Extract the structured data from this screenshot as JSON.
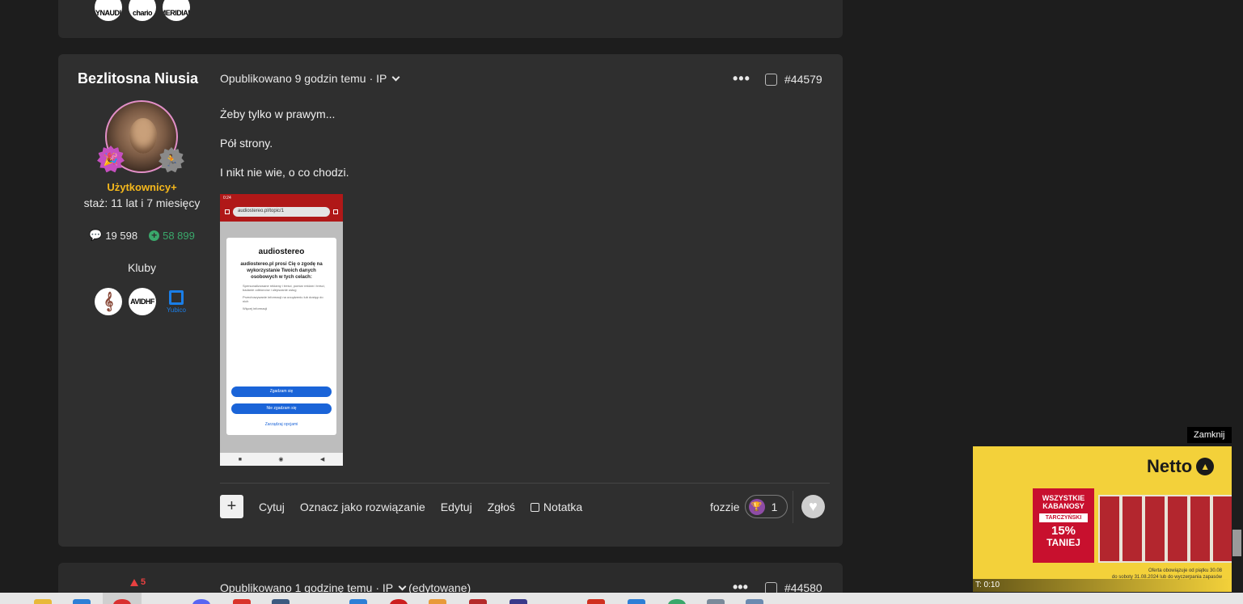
{
  "prev_post": {
    "clubs": [
      "DYNAUDIO",
      "chario",
      "MERIDIAN"
    ]
  },
  "post": {
    "author": {
      "name": "Bezlitosna Niusia",
      "group": "Użytkownicy+",
      "since": "staż: 11 lat i 7 miesięcy",
      "posts_count": "19 598",
      "reputation": "58 899",
      "clubs_label": "Kluby",
      "clubs": [
        "",
        "AVIDHF",
        "Yubico"
      ]
    },
    "header": {
      "published": "Opublikowano 9 godzin temu",
      "ip": "· IP",
      "post_number": "#44579"
    },
    "content": {
      "lines": [
        "Żeby tylko w prawym...",
        "Pół strony.",
        "I nikt nie wie, o co chodzi."
      ]
    },
    "embedded_screenshot": {
      "status": "0:24",
      "url": "audiostereo.pl/topic/1",
      "logo": "audiostereo",
      "title": "audiostereo.pl prosi Cię o zgodę na wykorzystanie Twoich danych osobowych w tych celach:",
      "purpose_1": "Spersonalizowane reklamy i treści, pomiar reklam i treści, badanie odbiorców i ulepszanie usług",
      "purpose_2": "Przechowywanie informacji na urządzeniu lub dostęp do nich",
      "more_info": "Więcej informacji",
      "accept": "Zgadzam się",
      "reject": "Nie zgadzam się",
      "manage": "Zarządzaj opcjami"
    },
    "actions": {
      "quote": "Cytuj",
      "mark_solution": "Oznacz jako rozwiązanie",
      "edit": "Edytuj",
      "report": "Zgłoś",
      "note": "Notatka"
    },
    "reactions": {
      "user": "fozzie",
      "count": "1"
    }
  },
  "next_post": {
    "votes": "5",
    "published": "Opublikowano 1 godzinę temu",
    "ip": "· IP",
    "edited": "(edytowane)",
    "post_number": "#44580"
  },
  "ad": {
    "close_label": "Zamknij",
    "brand": "Netto",
    "promo_line1": "WSZYSTKIE",
    "promo_line2": "KABANOSY",
    "promo_brand": "TARCZYŃSKI",
    "promo_pct": "15%",
    "promo_word": "TANIEJ",
    "fine_print_1": "Oferta obowiązuje od piątku 30.08",
    "fine_print_2": "do soboty 31.08.2024 lub do wyczerpania zapasów",
    "timer": "T: 0:10"
  }
}
